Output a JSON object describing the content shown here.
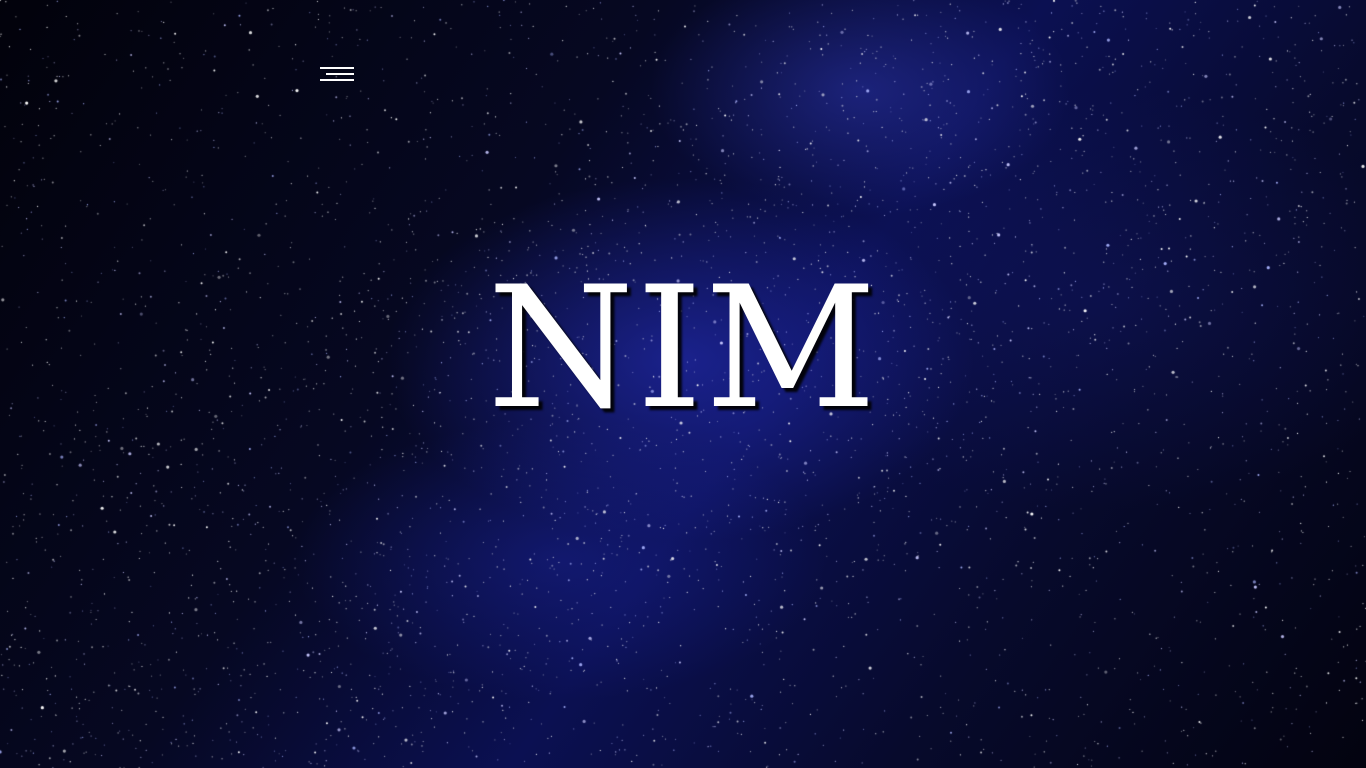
{
  "hero": {
    "title": "NIM"
  },
  "menu": {
    "icon": "hamburger-menu-icon"
  },
  "colors": {
    "background_dark": "#03030f",
    "nebula_blue": "#2832c8",
    "title_text": "#ffffff"
  }
}
